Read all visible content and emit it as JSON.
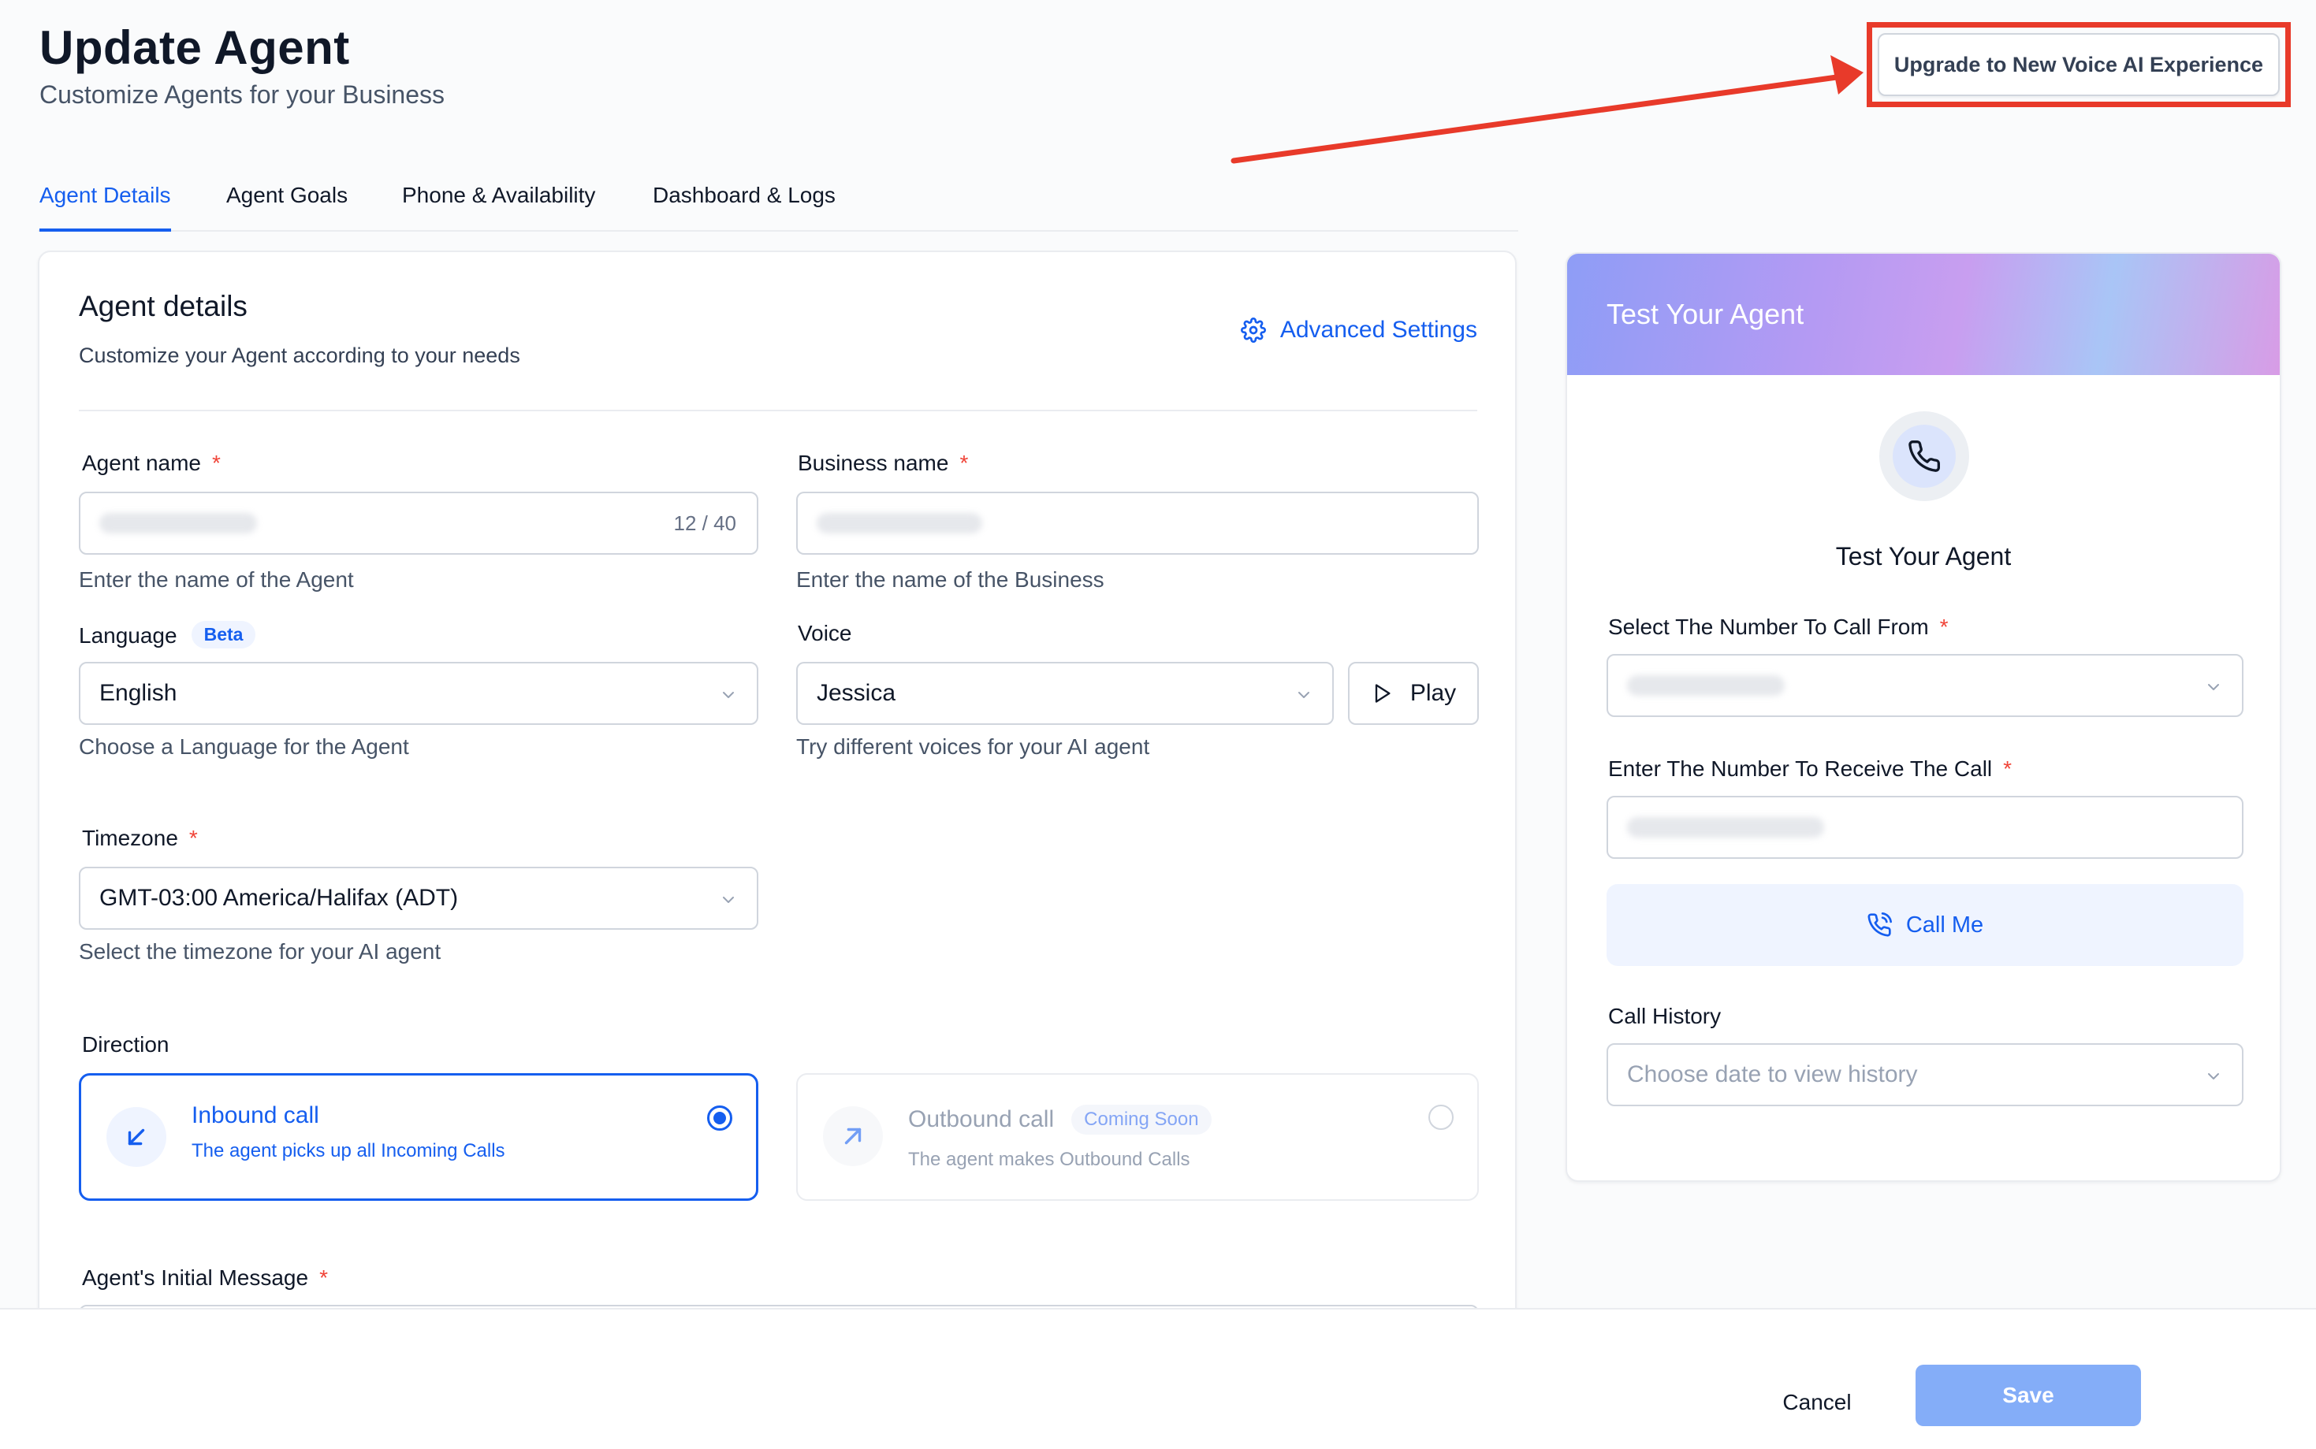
{
  "header": {
    "title": "Update Agent",
    "subtitle": "Customize Agents for your Business",
    "upgrade_button": "Upgrade to New Voice AI Experience",
    "annotation_color": "#e83a2a"
  },
  "tabs": [
    {
      "label": "Agent Details",
      "active": true
    },
    {
      "label": "Agent Goals",
      "active": false
    },
    {
      "label": "Phone & Availability",
      "active": false
    },
    {
      "label": "Dashboard & Logs",
      "active": false
    }
  ],
  "agent_details": {
    "title": "Agent details",
    "subtitle": "Customize your Agent according to your needs",
    "advanced_settings": "Advanced Settings",
    "agent_name": {
      "label": "Agent name",
      "required_mark": "*",
      "counter": "12 / 40",
      "help": "Enter the name of the Agent"
    },
    "business_name": {
      "label": "Business name",
      "required_mark": "*",
      "help": "Enter the name of the Business"
    },
    "language": {
      "label": "Language",
      "badge": "Beta",
      "value": "English",
      "help": "Choose a Language for the Agent"
    },
    "voice": {
      "label": "Voice",
      "value": "Jessica",
      "play_label": "Play",
      "help": "Try different voices for your AI agent"
    },
    "timezone": {
      "label": "Timezone",
      "required_mark": "*",
      "value": "GMT-03:00 America/Halifax (ADT)",
      "help": "Select the timezone for your AI agent"
    },
    "direction": {
      "label": "Direction",
      "inbound": {
        "title": "Inbound call",
        "desc": "The agent picks up all Incoming Calls",
        "selected": true
      },
      "outbound": {
        "title": "Outbound call",
        "badge": "Coming Soon",
        "desc": "The agent makes Outbound Calls",
        "selected": false
      }
    },
    "initial_message": {
      "label": "Agent's Initial Message",
      "required_mark": "*"
    }
  },
  "test_panel": {
    "header_title": "Test Your Agent",
    "title": "Test Your Agent",
    "from_label": "Select The Number To Call From",
    "to_label": "Enter The Number To Receive The Call",
    "call_button": "Call Me",
    "history_label": "Call History",
    "history_placeholder": "Choose date to view history",
    "required_mark": "*"
  },
  "footer": {
    "cancel": "Cancel",
    "save": "Save"
  },
  "colors": {
    "accent": "#155eef",
    "save_disabled": "#84adf8",
    "required": "#f04438"
  }
}
